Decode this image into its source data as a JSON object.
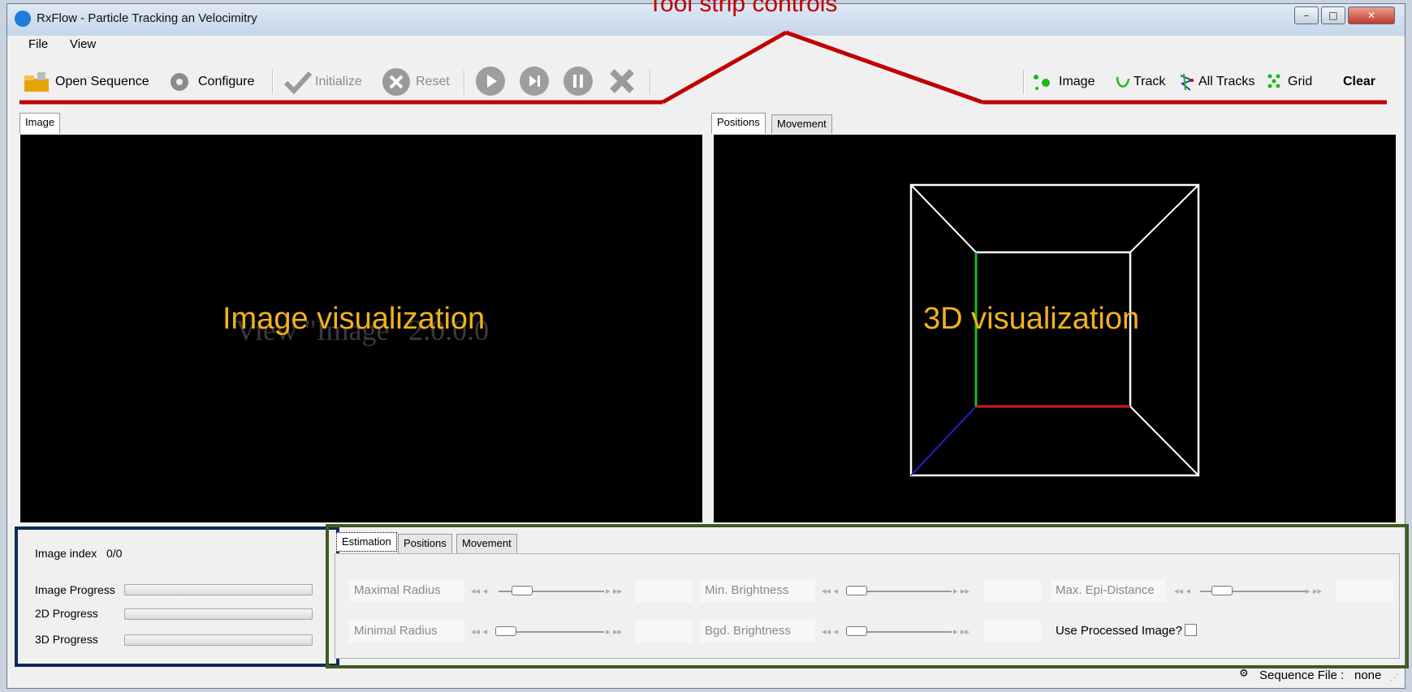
{
  "window": {
    "title": "RxFlow - Particle Tracking an Velocimitry"
  },
  "menu": [
    "File",
    "View"
  ],
  "toolbar": {
    "open_sequence": "Open Sequence",
    "configure": "Configure",
    "initialize": "Initialize",
    "reset": "Reset",
    "image": "Image",
    "track": "Track",
    "all_tracks": "All Tracks",
    "grid": "Grid",
    "clear": "Clear"
  },
  "left_panel": {
    "tab": "Image",
    "background_text": "View \"Image\" 2.0.0.0"
  },
  "right_panel": {
    "tabs": [
      "Positions",
      "Movement"
    ]
  },
  "status_panel": {
    "image_index_label": "Image index",
    "image_index_value": "0/0",
    "image_progress": "Image Progress",
    "progress_2d": "2D Progress",
    "progress_3d": "3D Progress"
  },
  "param_tabs": [
    "Estimation",
    "Positions",
    "Movement"
  ],
  "params": {
    "maximal_radius": "Maximal Radius",
    "minimal_radius": "Minimal Radius",
    "min_brightness": "Min. Brightness",
    "bgd_brightness": "Bgd. Brightness",
    "max_epi_distance": "Max. Epi-Distance",
    "use_processed_image": "Use Processed Image?"
  },
  "statusbar": {
    "sequence_file_label": "Sequence File :",
    "sequence_file_value": "none"
  },
  "annotations": {
    "toolstrip": "Tool strip controls",
    "image_vis": "Image visualization",
    "vis_3d": "3D visualization"
  },
  "colors": {
    "annotation_red": "#c00000",
    "annotation_text": "#f2b21a",
    "status_box": "#0e2a5a",
    "params_box": "#3f5a20"
  }
}
